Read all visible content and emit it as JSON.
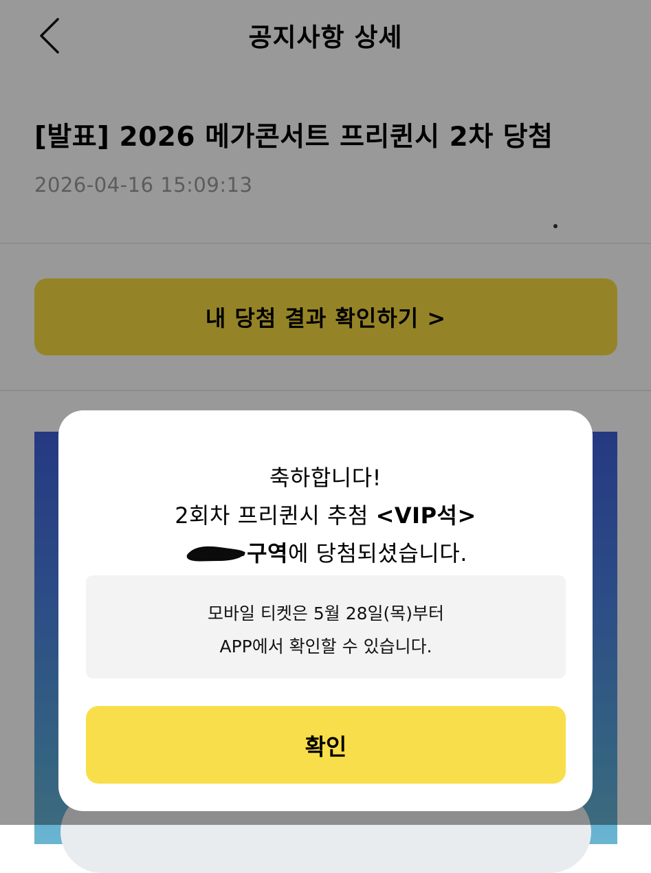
{
  "header": {
    "title": "공지사항 상세",
    "back_icon": "chevron-left-icon"
  },
  "notice": {
    "title": "[발표] 2026 메가콘서트 프리퀸시 2차 당첨",
    "date": "2026-04-16 15:09:13"
  },
  "result_button": {
    "label": "내 당첨 결과 확인하기 >"
  },
  "modal": {
    "line1": "축하합니다!",
    "line2_prefix": "2회차 프리퀸시 추첨 ",
    "line2_bold": "<VIP석>",
    "line3_bold": "구역",
    "line3_suffix": "에 당첨되셨습니다.",
    "info_line1": "모바일 티켓은 5월 28일(목)부터",
    "info_line2": "APP에서 확인할 수 있습니다.",
    "confirm_label": "확인"
  },
  "colors": {
    "accent_yellow": "#f8de4a",
    "date_gray": "#9a9a9a",
    "overlay": "rgba(0,0,0,0.40)"
  }
}
